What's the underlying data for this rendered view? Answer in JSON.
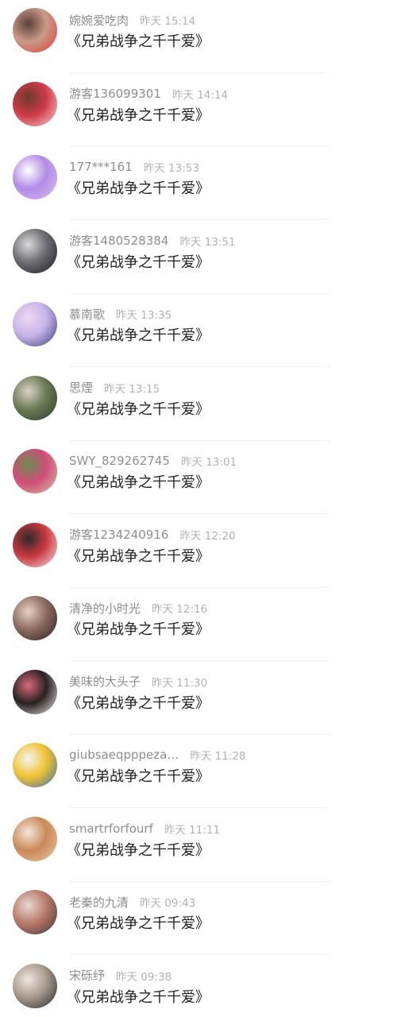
{
  "messages": [
    {
      "name": "婉婉爱吃肉",
      "time": "昨天 15:14",
      "text": "《兄弟战争之千千爱》",
      "colors": [
        "#e03b2f",
        "#c99a8a",
        "#5a4036"
      ]
    },
    {
      "name": "游客136099301",
      "time": "昨天 14:14",
      "text": "《兄弟战争之千千爱》",
      "colors": [
        "#f6d7d2",
        "#cf3a4a",
        "#6b3a2a"
      ]
    },
    {
      "name": "177***161",
      "time": "昨天 13:53",
      "text": "《兄弟战争之千千爱》",
      "colors": [
        "#d7c2f2",
        "#b38be6",
        "#ffffff"
      ]
    },
    {
      "name": "游客1480528384",
      "time": "昨天 13:51",
      "text": "《兄弟战争之千千爱》",
      "colors": [
        "#1b1b1f",
        "#6d6d72",
        "#d9d9d9"
      ]
    },
    {
      "name": "慕南歌",
      "time": "昨天 13:35",
      "text": "《兄弟战争之千千爱》",
      "colors": [
        "#3a3e7a",
        "#c6b4e8",
        "#f0d9f4"
      ]
    },
    {
      "name": "思煙",
      "time": "昨天 13:15",
      "text": "《兄弟战争之千千爱》",
      "colors": [
        "#2b3a2a",
        "#6b7a55",
        "#d8d2c4"
      ]
    },
    {
      "name": "SWY_829262745",
      "time": "昨天 13:01",
      "text": "《兄弟战争之千千爱》",
      "colors": [
        "#cfc59e",
        "#d14d7a",
        "#6b8e4e"
      ]
    },
    {
      "name": "游客1234240916",
      "time": "昨天 12:20",
      "text": "《兄弟战争之千千爱》",
      "colors": [
        "#f3e9ea",
        "#c9383f",
        "#2e2a2a"
      ]
    },
    {
      "name": "清净的小时光",
      "time": "昨天 12:16",
      "text": "《兄弟战争之千千爱》",
      "colors": [
        "#2a2020",
        "#8c6a5f",
        "#e6d0c8"
      ]
    },
    {
      "name": "美味的大头子",
      "time": "昨天 11:30",
      "text": "《兄弟战争之千千爱》",
      "colors": [
        "#f4ecec",
        "#2a2222",
        "#d86a7a"
      ]
    },
    {
      "name": "giubsaeqpppeza…",
      "time": "昨天 11:28",
      "text": "《兄弟战争之千千爱》",
      "colors": [
        "#2f6fb8",
        "#f2c230",
        "#f5f5f5"
      ]
    },
    {
      "name": "smartrforfourf",
      "time": "昨天 11:11",
      "text": "《兄弟战争之千千爱》",
      "colors": [
        "#e8c9a8",
        "#c98a58",
        "#f4e7da"
      ]
    },
    {
      "name": "老秦的九清",
      "time": "昨天 09:43",
      "text": "《兄弟战争之千千爱》",
      "colors": [
        "#3b3436",
        "#b87a6a",
        "#e9d9d0"
      ]
    },
    {
      "name": "宋砾纾",
      "time": "昨天 09:38",
      "text": "《兄弟战争之千千爱》",
      "colors": [
        "#232526",
        "#a9998e",
        "#efe6df"
      ]
    }
  ]
}
